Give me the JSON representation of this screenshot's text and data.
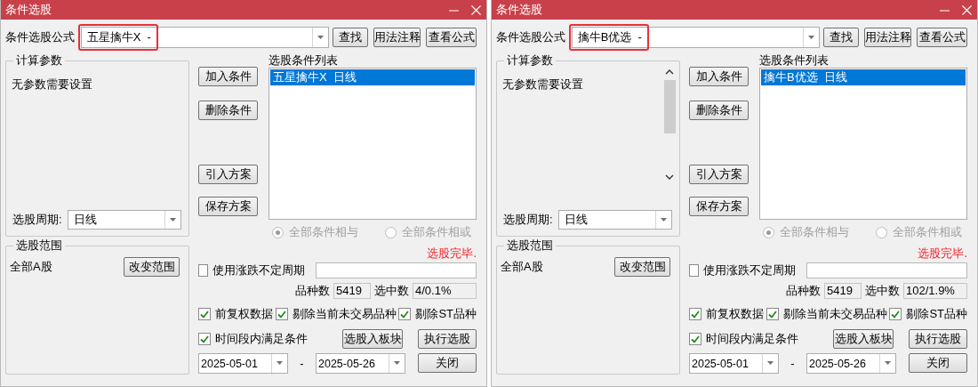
{
  "dialogs": [
    {
      "title": "条件选股",
      "formula_label": "条件选股公式",
      "formula_value": "五星擒牛X  -",
      "formula_highlighted": true,
      "top_buttons": [
        "查找",
        "用法注释",
        "查看公式"
      ],
      "params_title": "计算参数",
      "params_message": "无参数需要设置",
      "params_scrollbar": false,
      "period_label": "选股周期:",
      "period_value": "日线",
      "side_buttons": [
        "加入条件",
        "删除条件",
        "引入方案",
        "保存方案"
      ],
      "list_title": "选股条件列表",
      "list_items": [
        {
          "text": "五星擒牛X  日线",
          "selected": true
        }
      ],
      "radios": [
        {
          "label": "全部条件相与",
          "selected": true,
          "disabled": true
        },
        {
          "label": "全部条件相或",
          "selected": false,
          "disabled": true
        }
      ],
      "status": "选股完毕.",
      "scope_title": "选股范围",
      "scope_value": "全部A股",
      "scope_button": "改变范围",
      "uneven_period": {
        "label": "使用涨跌不定周期",
        "checked": false
      },
      "count_label": "品种数",
      "count_value": "5419",
      "picked_label": "选中数",
      "picked_value": "4/0.1%",
      "options": [
        {
          "label": "前复权数据",
          "checked": true
        },
        {
          "label": "剔除当前未交易品种",
          "checked": true
        },
        {
          "label": "剔除ST品种",
          "checked": true
        }
      ],
      "time_range": {
        "label": "时间段内满足条件",
        "checked": true
      },
      "board_button": "选股入板块",
      "run_button": "执行选股",
      "date_from": "2025-05-01",
      "date_separator": "-",
      "date_to": "2025-05-26",
      "close_button": "关闭"
    },
    {
      "title": "条件选股",
      "formula_label": "条件选股公式",
      "formula_value": "擒牛B优选  -",
      "formula_highlighted": true,
      "top_buttons": [
        "查找",
        "用法注释",
        "查看公式"
      ],
      "params_title": "计算参数",
      "params_message": "无参数需要设置",
      "params_scrollbar": true,
      "period_label": "选股周期:",
      "period_value": "日线",
      "side_buttons": [
        "加入条件",
        "删除条件",
        "引入方案",
        "保存方案"
      ],
      "list_title": "选股条件列表",
      "list_items": [
        {
          "text": "擒牛B优选  日线",
          "selected": true
        }
      ],
      "radios": [
        {
          "label": "全部条件相与",
          "selected": true,
          "disabled": true
        },
        {
          "label": "全部条件相或",
          "selected": false,
          "disabled": true
        }
      ],
      "status": "选股完毕.",
      "scope_title": "选股范围",
      "scope_value": "全部A股",
      "scope_button": "改变范围",
      "uneven_period": {
        "label": "使用涨跌不定周期",
        "checked": false
      },
      "count_label": "品种数",
      "count_value": "5419",
      "picked_label": "选中数",
      "picked_value": "102/1.9%",
      "options": [
        {
          "label": "前复权数据",
          "checked": true
        },
        {
          "label": "剔除当前未交易品种",
          "checked": true
        },
        {
          "label": "剔除ST品种",
          "checked": true
        }
      ],
      "time_range": {
        "label": "时间段内满足条件",
        "checked": true
      },
      "board_button": "选股入板块",
      "run_button": "执行选股",
      "date_from": "2025-05-01",
      "date_separator": "-",
      "date_to": "2025-05-26",
      "close_button": "关闭"
    }
  ]
}
